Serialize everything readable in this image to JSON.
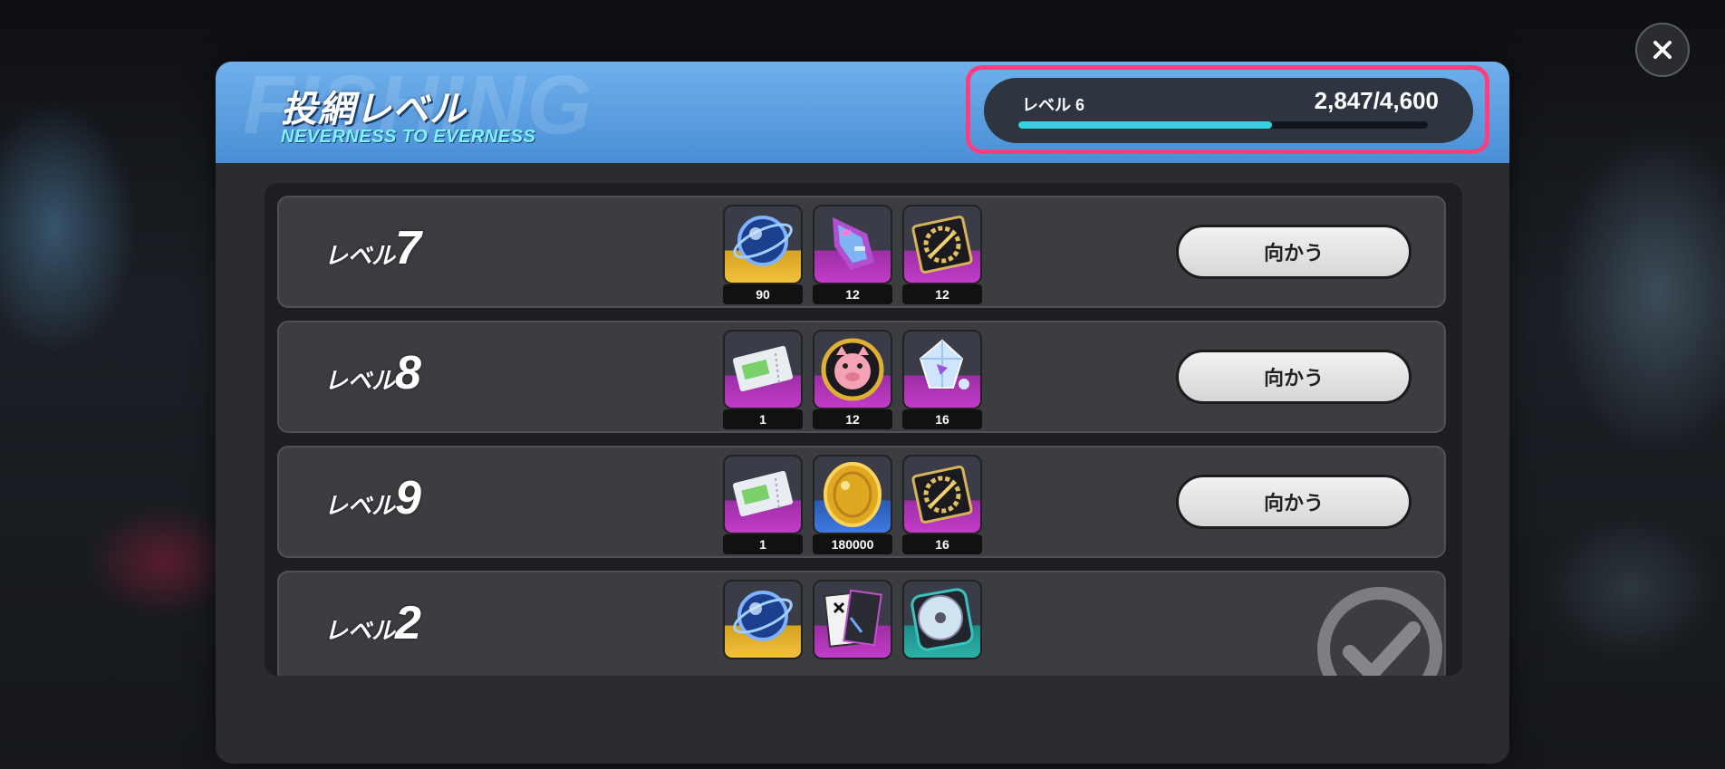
{
  "panel": {
    "title": "投網レベル",
    "subtitle": "NEVERNESS TO EVERNESS",
    "watermark": "FISHING"
  },
  "progress": {
    "level_label": "レベル 6",
    "value_text": "2,847/4,600",
    "current": 2847,
    "max": 4600,
    "fraction": 0.619,
    "highlight_color": "#ff3d7f",
    "fill_color": "#33d3e0"
  },
  "rows": [
    {
      "label_prefix": "レベル",
      "level": "7",
      "rewards": [
        {
          "icon": "blue-orb-icon",
          "rarity": "gold",
          "qty": "90"
        },
        {
          "icon": "glitch-shard-icon",
          "rarity": "purple",
          "qty": "12"
        },
        {
          "icon": "gear-tablet-icon",
          "rarity": "purple",
          "qty": "12"
        }
      ],
      "action": "向かう"
    },
    {
      "label_prefix": "レベル",
      "level": "8",
      "rewards": [
        {
          "icon": "ticket-icon",
          "rarity": "purple",
          "qty": "1"
        },
        {
          "icon": "pig-badge-icon",
          "rarity": "purple",
          "qty": "12"
        },
        {
          "icon": "crystal-icon",
          "rarity": "purple",
          "qty": "16"
        }
      ],
      "action": "向かう"
    },
    {
      "label_prefix": "レベル",
      "level": "9",
      "rewards": [
        {
          "icon": "ticket-icon",
          "rarity": "purple",
          "qty": "1"
        },
        {
          "icon": "gold-coin-icon",
          "rarity": "blue",
          "qty": "180000"
        },
        {
          "icon": "gear-tablet-icon",
          "rarity": "purple",
          "qty": "16"
        }
      ],
      "action": "向かう"
    },
    {
      "label_prefix": "レベル",
      "level": "2",
      "rewards": [
        {
          "icon": "blue-orb-icon",
          "rarity": "gold",
          "qty": ""
        },
        {
          "icon": "cards-icon",
          "rarity": "purple",
          "qty": ""
        },
        {
          "icon": "disc-icon",
          "rarity": "teal",
          "qty": ""
        }
      ],
      "status": "completed"
    }
  ]
}
